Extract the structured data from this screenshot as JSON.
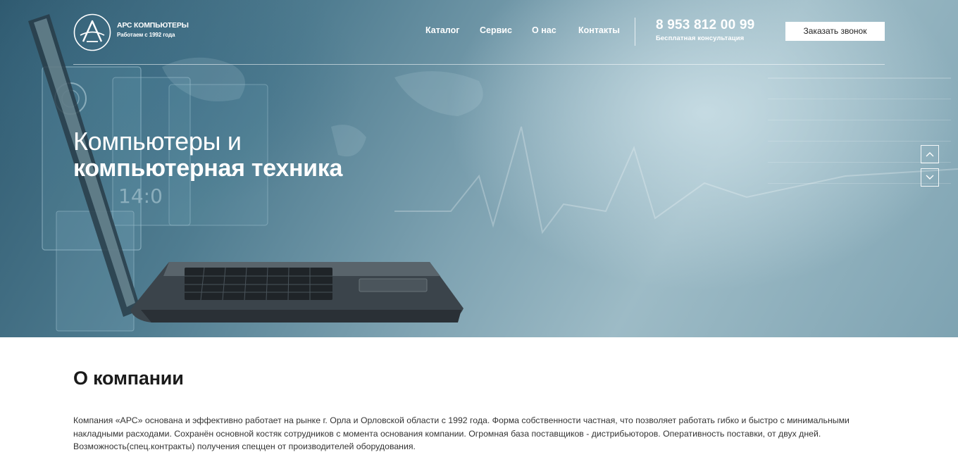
{
  "header": {
    "logo_name": "АРС КОМПЬЮТЕРЫ",
    "logo_sub": "Работаем с 1992 года",
    "nav": [
      "Каталог",
      "Сервис",
      "О нас",
      "Контакты"
    ],
    "phone": "8 953 812 00 99",
    "phone_sub": "Бесплатная  консультация",
    "callback_label": "Заказать звонок"
  },
  "hero": {
    "title_line1": "Компьютеры и",
    "title_line2": "компьютерная техника",
    "slide_controls": [
      "chevron-up-icon",
      "chevron-down-icon"
    ]
  },
  "about": {
    "title": "О компании",
    "text": "Компания «АРС» основана и эффективно работает на рынке г. Орла и Орловской области с 1992 года. Форма собственности частная, что позволяет работать гибко и быстро с минимальными накладными расходами. Сохранён основной костяк сотрудников с момента основания компании. Огромная база поставщиков - дистрибьюторов. Оперативность поставки, от двух дней. Возможность(спец.контракты) получения спеццен от производителей оборудования."
  },
  "colors": {
    "hero_dark": "#2f5a70",
    "hero_light": "#9dbbc6",
    "text_dark": "#1b1b1b",
    "button_bg": "#ffffff"
  }
}
